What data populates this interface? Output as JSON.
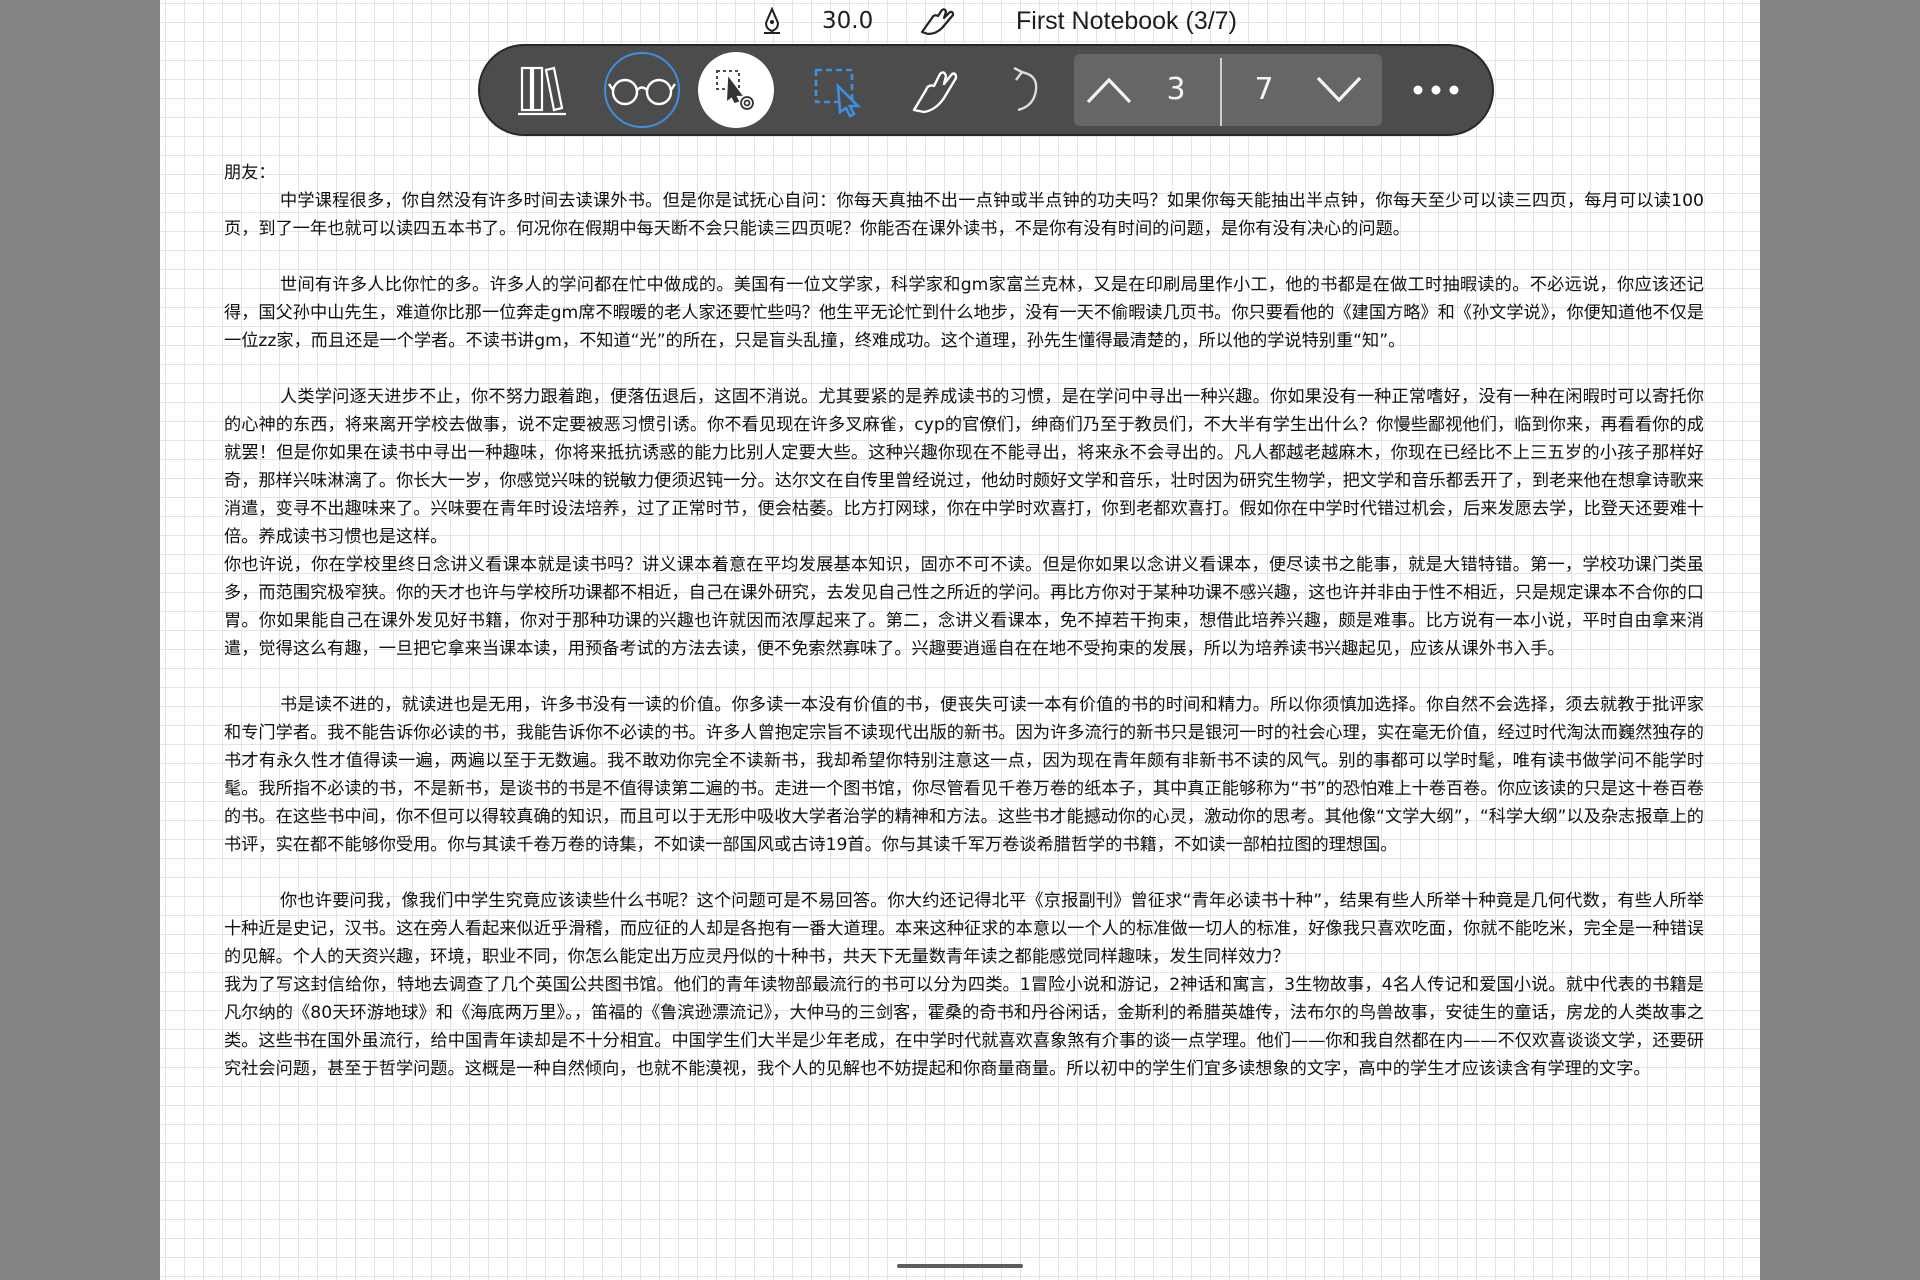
{
  "status_bar": {
    "pen_size": "30.0",
    "notebook_title": "First Notebook (3/7)"
  },
  "toolbar": {
    "icons": [
      "library-icon",
      "read-mode-icon",
      "lasso-settings-icon",
      "lasso-select-icon",
      "hand-icon",
      "undo-icon",
      "chevron-up-icon",
      "chevron-down-icon",
      "more-icon"
    ],
    "current_page": "3",
    "total_pages": "7",
    "active_color": "#3f8fe0"
  },
  "letter": {
    "salutation": "朋友：",
    "paragraphs": [
      "中学课程很多，你自然没有许多时间去读课外书。但是你是试抚心自问：你每天真抽不出一点钟或半点钟的功夫吗？如果你每天能抽出半点钟，你每天至少可以读三四页，每月可以读100页，到了一年也就可以读四五本书了。何况你在假期中每天断不会只能读三四页呢？你能否在课外读书，不是你有没有时间的问题，是你有没有决心的问题。",
      "世间有许多人比你忙的多。许多人的学问都在忙中做成的。美国有一位文学家，科学家和gm家富兰克林，又是在印刷局里作小工，他的书都是在做工时抽暇读的。不必远说，你应该还记得，国父孙中山先生，难道你比那一位奔走gm席不暇暖的老人家还要忙些吗？他生平无论忙到什么地步，没有一天不偷暇读几页书。你只要看他的《建国方略》和《孙文学说》，你便知道他不仅是一位zz家，而且还是一个学者。不读书讲gm，不知道“光”的所在，只是盲头乱撞，终难成功。这个道理，孙先生懂得最清楚的，所以他的学说特别重“知”。",
      "人类学问逐天进步不止，你不努力跟着跑，便落伍退后，这固不消说。尤其要紧的是养成读书的习惯，是在学问中寻出一种兴趣。你如果没有一种正常嗜好，没有一种在闲暇时可以寄托你的心神的东西，将来离开学校去做事，说不定要被恶习惯引诱。你不看见现在许多叉麻雀，cyp的官僚们，绅商们乃至于教员们，不大半有学生出什么？你慢些鄙视他们，临到你来，再看看你的成就罢！但是你如果在读书中寻出一种趣味，你将来抵抗诱惑的能力比别人定要大些。这种兴趣你现在不能寻出，将来永不会寻出的。凡人都越老越麻木，你现在已经比不上三五岁的小孩子那样好奇，那样兴味淋漓了。你长大一岁，你感觉兴味的锐敏力便须迟钝一分。达尔文在自传里曾经说过，他幼时颇好文学和音乐，壮时因为研究生物学，把文学和音乐都丢开了，到老来他在想拿诗歌来消遣，变寻不出趣味来了。兴味要在青年时设法培养，过了正常时节，便会枯萎。比方打网球，你在中学时欢喜打，你到老都欢喜打。假如你在中学时代错过机会，后来发愿去学，比登天还要难十倍。养成读书习惯也是这样。",
      "你也许说，你在学校里终日念讲义看课本就是读书吗？讲义课本着意在平均发展基本知识，固亦不可不读。但是你如果以念讲义看课本，便尽读书之能事，就是大错特错。第一，学校功课门类虽多，而范围究极窄狭。你的天才也许与学校所功课都不相近，自己在课外研究，去发见自己性之所近的学问。再比方你对于某种功课不感兴趣，这也许并非由于性不相近，只是规定课本不合你的口胃。你如果能自己在课外发见好书籍，你对于那种功课的兴趣也许就因而浓厚起来了。第二，念讲义看课本，免不掉若干拘束，想借此培养兴趣，颇是难事。比方说有一本小说，平时自由拿来消遣，觉得这么有趣，一旦把它拿来当课本读，用预备考试的方法去读，便不免索然寡味了。兴趣要逍遥自在在地不受拘束的发展，所以为培养读书兴趣起见，应该从课外书入手。",
      "书是读不进的，就读进也是无用，许多书没有一读的价值。你多读一本没有价值的书，便丧失可读一本有价值的书的时间和精力。所以你须慎加选择。你自然不会选择，须去就教于批评家和专门学者。我不能告诉你必读的书，我能告诉你不必读的书。许多人曾抱定宗旨不读现代出版的新书。因为许多流行的新书只是银河一时的社会心理，实在毫无价值，经过时代淘汰而巍然独存的书才有永久性才值得读一遍，两遍以至于无数遍。我不敢劝你完全不读新书，我却希望你特别注意这一点，因为现在青年颇有非新书不读的风气。别的事都可以学时髦，唯有读书做学问不能学时髦。我所指不必读的书，不是新书，是谈书的书是不值得读第二遍的书。走进一个图书馆，你尽管看见千卷万卷的纸本子，其中真正能够称为“书”的恐怕难上十卷百卷。你应该读的只是这十卷百卷的书。在这些书中间，你不但可以得较真确的知识，而且可以于无形中吸收大学者治学的精神和方法。这些书才能撼动你的心灵，激动你的思考。其他像“文学大纲”，“科学大纲”以及杂志报章上的书评，实在都不能够你受用。你与其读千卷万卷的诗集，不如读一部国风或古诗19首。你与其读千军万卷谈希腊哲学的书籍，不如读一部柏拉图的理想国。",
      "你也许要问我，像我们中学生究竟应该读些什么书呢？这个问题可是不易回答。你大约还记得北平《京报副刊》曾征求“青年必读书十种”，结果有些人所举十种竟是几何代数，有些人所举十种近是史记，汉书。这在旁人看起来似近乎滑稽，而应征的人却是各抱有一番大道理。本来这种征求的本意以一个人的标准做一切人的标准，好像我只喜欢吃面，你就不能吃米，完全是一种错误的见解。个人的天资兴趣，环境，职业不同，你怎么能定出万应灵丹似的十种书，共天下无量数青年读之都能感觉同样趣味，发生同样效力？",
      "我为了写这封信给你，特地去调查了几个英国公共图书馆。他们的青年读物部最流行的书可以分为四类。1冒险小说和游记，2神话和寓言，3生物故事，4名人传记和爱国小说。就中代表的书籍是凡尔纳的《80天环游地球》和《海底两万里》。，笛福的《鲁滨逊漂流记》，大仲马的三剑客，霍桑的奇书和丹谷闲话，金斯利的希腊英雄传，法布尔的鸟兽故事，安徒生的童话，房龙的人类故事之类。这些书在国外虽流行，给中国青年读却是不十分相宜。中国学生们大半是少年老成，在中学时代就喜欢喜象煞有介事的谈一点学理。他们——你和我自然都在内——不仅欢喜谈谈文学，还要研究社会问题，甚至于哲学问题。这概是一种自然倾向，也就不能漠视，我个人的见解也不妨提起和你商量商量。所以初中的学生们宜多读想象的文字，高中的学生才应该读含有学理的文字。"
    ]
  }
}
